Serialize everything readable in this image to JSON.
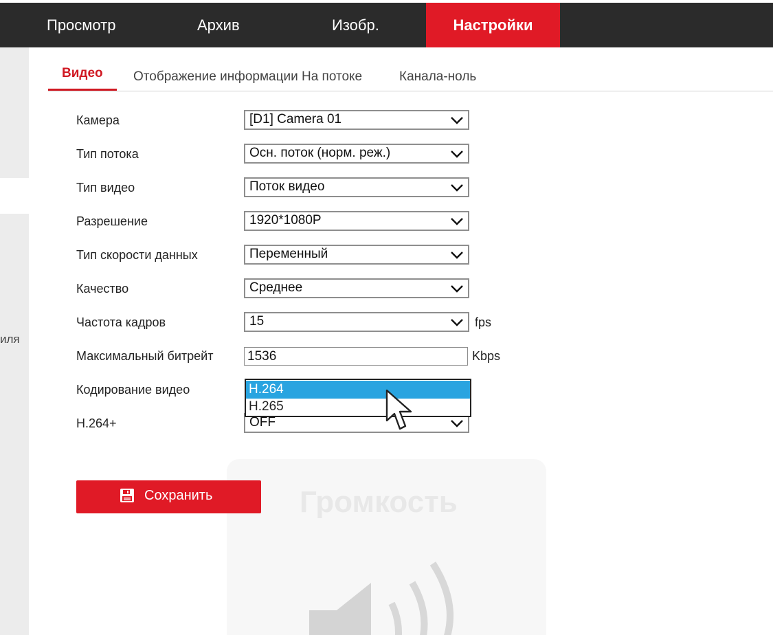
{
  "nav": {
    "items": [
      {
        "label": "Просмотр"
      },
      {
        "label": "Архив"
      },
      {
        "label": "Изобр."
      },
      {
        "label": "Настройки"
      }
    ],
    "active_color": "#e01a26",
    "bar_color": "#2b2b2b"
  },
  "sidebar": {
    "partial_label": "иля"
  },
  "subtabs": [
    {
      "label": "Видео"
    },
    {
      "label": "Отображение информации На потоке"
    },
    {
      "label": "Канала-ноль"
    }
  ],
  "form": {
    "camera": {
      "label": "Камера",
      "value": "[D1] Camera 01"
    },
    "stream_type": {
      "label": "Тип потока",
      "value": "Осн. поток (норм. реж.)"
    },
    "video_type": {
      "label": "Тип видео",
      "value": "Поток видео"
    },
    "resolution": {
      "label": "Разрешение",
      "value": "1920*1080P"
    },
    "bitrate_type": {
      "label": "Тип скорости данных",
      "value": "Переменный"
    },
    "quality": {
      "label": "Качество",
      "value": "Среднее"
    },
    "frame_rate": {
      "label": "Частота кадров",
      "value": "15",
      "unit": "fps"
    },
    "max_bitrate": {
      "label": "Максимальный битрейт",
      "value": "1536",
      "unit": "Kbps"
    },
    "video_encoding": {
      "label": "Кодирование видео",
      "options": [
        "H.264",
        "H.265"
      ],
      "selected": "H.264"
    },
    "h264plus": {
      "label": "H.264+",
      "value": "OFF"
    }
  },
  "save_button": {
    "label": "Сохранить",
    "icon": "save-icon"
  },
  "overlay": {
    "title": "Громкость",
    "icon": "volume-icon"
  },
  "colors": {
    "accent": "#e01a26",
    "option_highlight": "#29a4e0"
  }
}
